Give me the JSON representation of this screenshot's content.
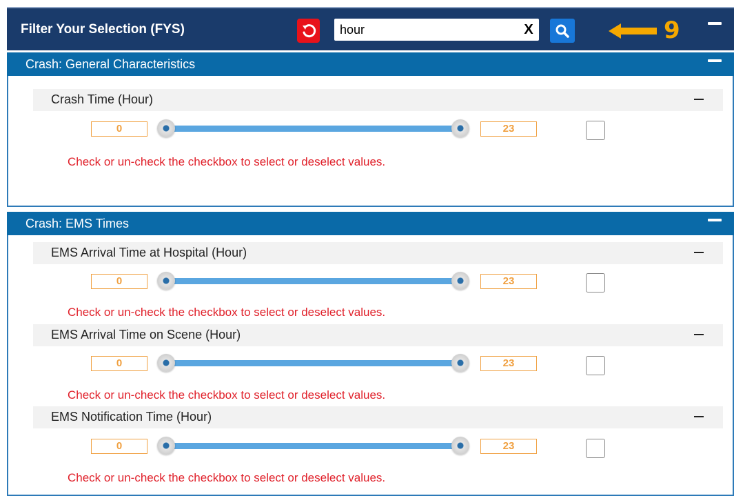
{
  "header": {
    "title": "Filter Your Selection (FYS)",
    "search_value": "hour",
    "clear_label": "X",
    "step_number": "9",
    "accent_color": "#1a3b6b",
    "reset_color": "#e8121a",
    "search_button_color": "#1877d8",
    "indicator_color": "#f5a800"
  },
  "sections": [
    {
      "title": "Crash: General Characteristics",
      "filters": [
        {
          "label": "Crash Time (Hour)",
          "min": "0",
          "max": "23",
          "hint": "Check or un-check the checkbox to select or deselect values."
        }
      ]
    },
    {
      "title": "Crash: EMS Times",
      "filters": [
        {
          "label": "EMS Arrival Time at Hospital (Hour)",
          "min": "0",
          "max": "23",
          "hint": "Check or un-check the checkbox to select or deselect values."
        },
        {
          "label": "EMS Arrival Time on Scene (Hour)",
          "min": "0",
          "max": "23",
          "hint": "Check or un-check the checkbox to select or deselect values."
        },
        {
          "label": "EMS Notification Time (Hour)",
          "min": "0",
          "max": "23",
          "hint": "Check or un-check the checkbox to select or deselect values."
        }
      ]
    }
  ]
}
